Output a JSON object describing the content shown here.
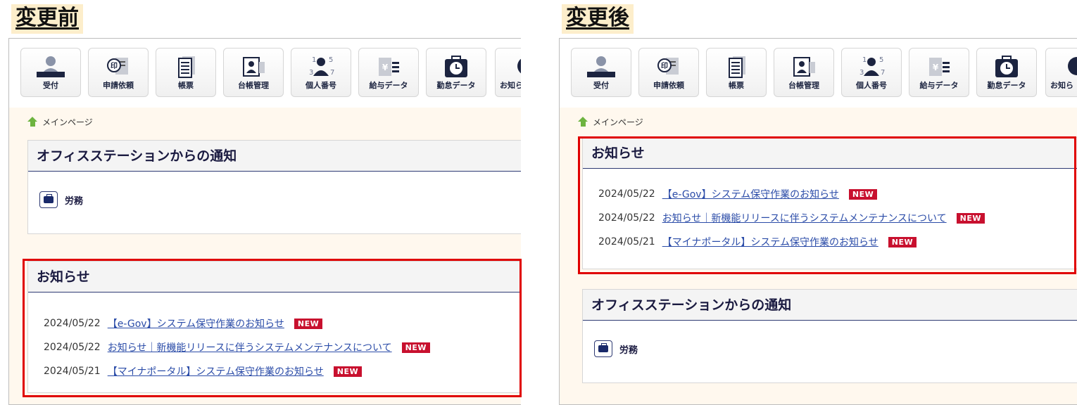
{
  "labels": {
    "before": "変更前",
    "after": "変更後"
  },
  "toolbar": [
    {
      "label": "受付",
      "icon": "reception-icon"
    },
    {
      "label": "申請依頼",
      "icon": "stamp-request-icon"
    },
    {
      "label": "帳票",
      "icon": "document-icon"
    },
    {
      "label": "台帳管理",
      "icon": "ledger-icon"
    },
    {
      "label": "個人番号",
      "icon": "id-number-icon"
    },
    {
      "label": "給与データ",
      "icon": "payroll-icon"
    },
    {
      "label": "勤怠データ",
      "icon": "attendance-clock-icon"
    },
    {
      "label": "お知ら",
      "icon": "notice-icon"
    }
  ],
  "breadcrumb": "メインページ",
  "office_notice": {
    "title": "オフィスステーションからの通知",
    "item": "労務"
  },
  "news": {
    "title": "お知らせ",
    "items": [
      {
        "date": "2024/05/22",
        "text": "【e-Gov】システム保守作業のお知らせ",
        "badge": "NEW"
      },
      {
        "date": "2024/05/22",
        "text": "お知らせ｜新機能リリースに伴うシステムメンテナンスについて",
        "badge": "NEW"
      },
      {
        "date": "2024/05/21",
        "text": "【マイナポータル】システム保守作業のお知らせ",
        "badge": "NEW"
      }
    ]
  },
  "colors": {
    "highlight": "#e00000",
    "badge": "#c8102e",
    "link": "#2b4ca8",
    "accent": "#2e3a73"
  }
}
